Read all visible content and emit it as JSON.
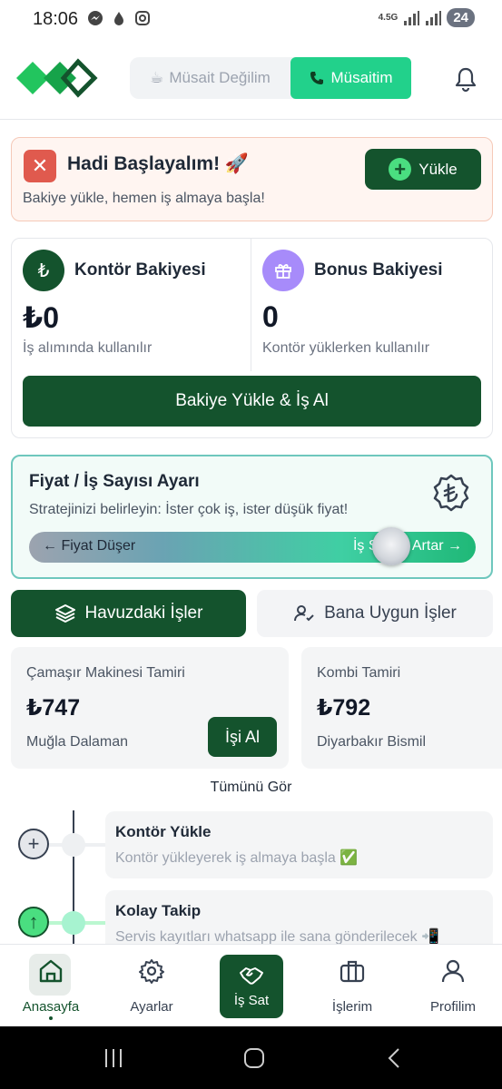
{
  "status_bar": {
    "time": "18:06",
    "network": "4.5G",
    "battery": "24"
  },
  "header": {
    "unavailable_label": "Müsait Değilim",
    "available_label": "Müsaitim"
  },
  "alert": {
    "title": "Hadi Başlayalım! 🚀",
    "subtitle": "Bakiye yükle, hemen iş almaya başla!",
    "load_button": "Yükle"
  },
  "balances": {
    "contour": {
      "icon_symbol": "₺",
      "title": "Kontör Bakiyesi",
      "amount": "₺0",
      "description": "İş alımında kullanılır"
    },
    "bonus": {
      "title": "Bonus Bakiyesi",
      "amount": "0",
      "description": "Kontör yüklerken kullanılır"
    },
    "action_button": "Bakiye Yükle & İş Al"
  },
  "price_setting": {
    "title": "Fiyat / İş Sayısı Ayarı",
    "subtitle": "Stratejinizi belirleyin: İster çok iş, ister düşük fiyat!",
    "left_label": "← Fiyat Düşer",
    "right_label": "İş Sayısı Artar →",
    "slider_value": 0.84
  },
  "tabs": {
    "pool": "Havuzdaki İşler",
    "suitable": "Bana Uygun İşler"
  },
  "jobs": [
    {
      "title": "Çamaşır Makinesi Tamiri",
      "price": "₺747",
      "location": "Muğla Dalaman",
      "action": "İşi Al"
    },
    {
      "title": "Kombi Tamiri",
      "price": "₺792",
      "location": "Diyarbakır Bismil"
    }
  ],
  "see_all": "Tümünü Gör",
  "timeline": [
    {
      "title": "Kontör Yükle",
      "description": "Kontör yükleyerek iş almaya başla ✅"
    },
    {
      "title": "Kolay Takip",
      "description": "Servis kayıtları whatsapp ile sana gönderilecek 📲"
    }
  ],
  "bottom_nav": {
    "home": "Anasayfa",
    "settings": "Ayarlar",
    "sell": "İş Sat",
    "jobs": "İşlerim",
    "profile": "Profilim"
  },
  "colors": {
    "primary": "#14532d",
    "accent": "#22d18b",
    "alert_bg": "#fff5f1",
    "danger": "#e05a4e",
    "bonus": "#a78bfa"
  }
}
